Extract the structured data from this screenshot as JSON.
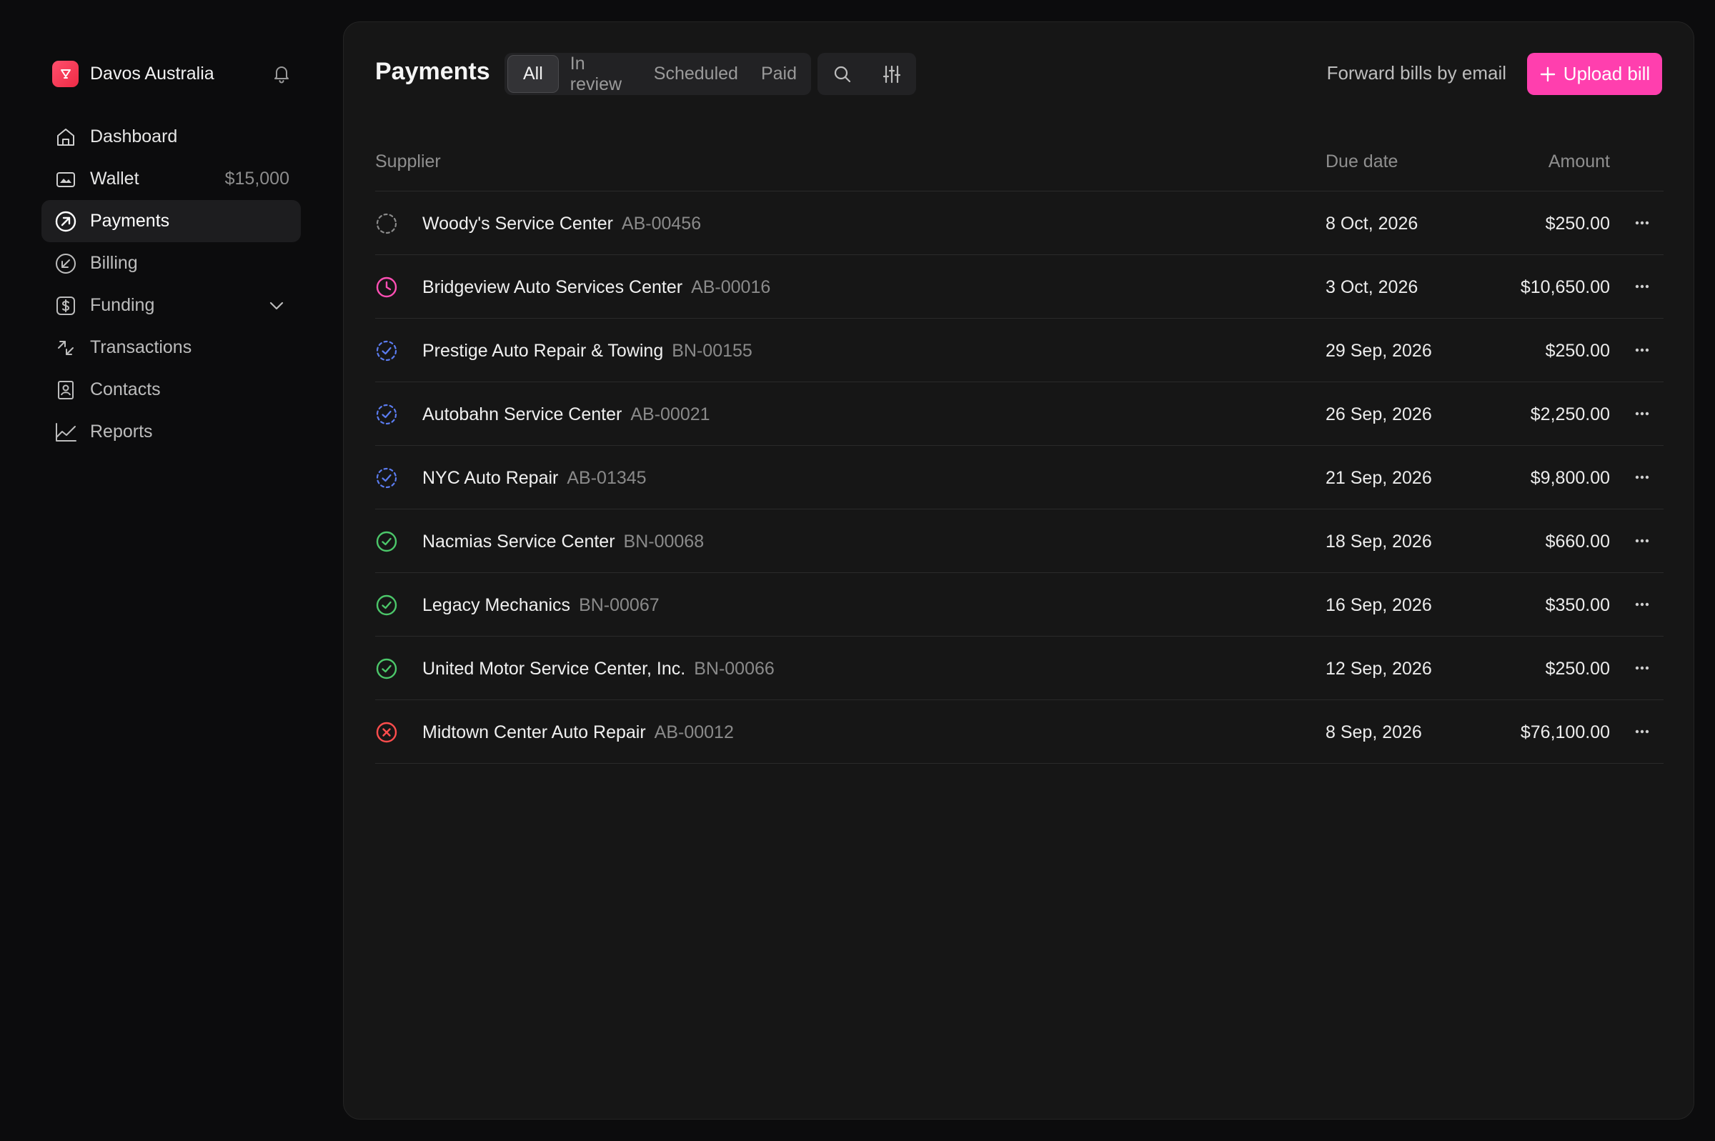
{
  "org": {
    "name": "Davos Australia",
    "logo_color": "#ff3b57"
  },
  "nav": [
    {
      "label": "Dashboard",
      "icon": "home-icon"
    },
    {
      "label": "Wallet",
      "icon": "wallet-icon",
      "value": "$15,000"
    },
    {
      "label": "Payments",
      "icon": "arrow-up-right-circle-icon",
      "active": true
    },
    {
      "label": "Billing",
      "icon": "arrow-down-left-circle-icon"
    },
    {
      "label": "Funding",
      "icon": "dollar-square-icon",
      "expandable": true
    },
    {
      "label": "Transactions",
      "icon": "transfer-arrows-icon"
    },
    {
      "label": "Contacts",
      "icon": "contact-book-icon"
    },
    {
      "label": "Reports",
      "icon": "line-chart-icon"
    }
  ],
  "header": {
    "title": "Payments",
    "tabs": [
      "All",
      "In review",
      "Scheduled",
      "Paid"
    ],
    "active_tab": "All",
    "forward_label": "Forward bills by email",
    "upload_label": "Upload bill"
  },
  "table": {
    "columns": {
      "supplier": "Supplier",
      "due": "Due date",
      "amount": "Amount"
    },
    "rows": [
      {
        "status": "draft",
        "supplier": "Woody's Service Center",
        "id": "AB-00456",
        "due": "8 Oct, 2026",
        "amount": "$250.00"
      },
      {
        "status": "in-review",
        "supplier": "Bridgeview Auto Services Center",
        "id": "AB-00016",
        "due": "3 Oct, 2026",
        "amount": "$10,650.00"
      },
      {
        "status": "scheduled",
        "supplier": "Prestige Auto Repair & Towing",
        "id": "BN-00155",
        "due": "29 Sep, 2026",
        "amount": "$250.00"
      },
      {
        "status": "scheduled",
        "supplier": "Autobahn Service Center",
        "id": "AB-00021",
        "due": "26 Sep, 2026",
        "amount": "$2,250.00"
      },
      {
        "status": "scheduled",
        "supplier": "NYC Auto Repair",
        "id": "AB-01345",
        "due": "21 Sep, 2026",
        "amount": "$9,800.00"
      },
      {
        "status": "paid",
        "supplier": "Nacmias Service Center",
        "id": "BN-00068",
        "due": "18 Sep, 2026",
        "amount": "$660.00"
      },
      {
        "status": "paid",
        "supplier": "Legacy Mechanics",
        "id": "BN-00067",
        "due": "16 Sep, 2026",
        "amount": "$350.00"
      },
      {
        "status": "paid",
        "supplier": "United Motor Service Center, Inc.",
        "id": "BN-00066",
        "due": "12 Sep, 2026",
        "amount": "$250.00"
      },
      {
        "status": "failed",
        "supplier": "Midtown Center Auto Repair",
        "id": "AB-00012",
        "due": "8 Sep, 2026",
        "amount": "$76,100.00"
      }
    ]
  },
  "colors": {
    "accent": "#ff3fae",
    "in_review": "#ff4fb4",
    "scheduled": "#5b7cf0",
    "paid": "#4cc76a",
    "failed": "#ff4d4d",
    "draft": "#8a8a8a"
  }
}
